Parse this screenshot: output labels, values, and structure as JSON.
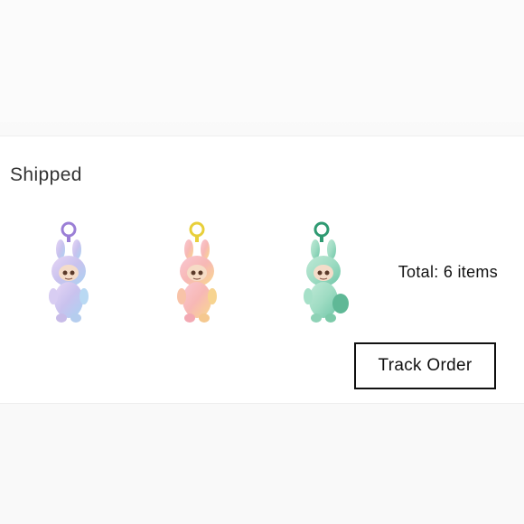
{
  "order": {
    "status": "Shipped",
    "items": [
      {
        "icon": "plush-keychain-lavender-icon",
        "body_color": "#c9c2ee",
        "accent_color": "#a9d3f2",
        "ring_color": "#9b7fd6"
      },
      {
        "icon": "plush-keychain-peach-icon",
        "body_color": "#f7b8b5",
        "accent_color": "#f9d98c",
        "ring_color": "#e8cf3a"
      },
      {
        "icon": "plush-keychain-mint-icon",
        "body_color": "#9fdcc3",
        "accent_color": "#6fc6a8",
        "ring_color": "#2f9a72"
      }
    ],
    "total_label": "Total: 6 items",
    "track_button_label": "Track Order"
  }
}
